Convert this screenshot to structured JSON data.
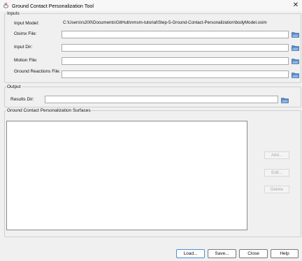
{
  "window": {
    "title": "Ground Contact Personalization Tool",
    "app_icon": "java-cup-icon",
    "close_glyph": "✕"
  },
  "inputs": {
    "legend": "Inputs",
    "input_model_label": "Input Model:",
    "input_model_value": "C:\\Users\\rs200\\Documents\\GitHub\\nmsm-tutorial\\Step-5-Ground-Contact-Personalization\\bodyModel.osim",
    "osimx_label": "Osimx File:",
    "osimx_value": "",
    "input_dir_label": "Input Dir:",
    "input_dir_value": "",
    "motion_label": "Motion File:",
    "motion_value": "",
    "grf_label": "Ground Reactions File:",
    "grf_value": ""
  },
  "output": {
    "legend": "Output",
    "results_dir_label": "Results Dir:",
    "results_dir_value": ""
  },
  "surfaces": {
    "legend": "Ground Contact Personalization Surfaces",
    "add_label": "Add...",
    "edit_label": "Edit...",
    "delete_label": "Delete"
  },
  "footer": {
    "load_label": "Load...",
    "save_label": "Save...",
    "close_label": "Close",
    "help_label": "Help"
  },
  "colors": {
    "folder_icon": "#3d6fb0",
    "primary_border": "#4c8fd6"
  }
}
